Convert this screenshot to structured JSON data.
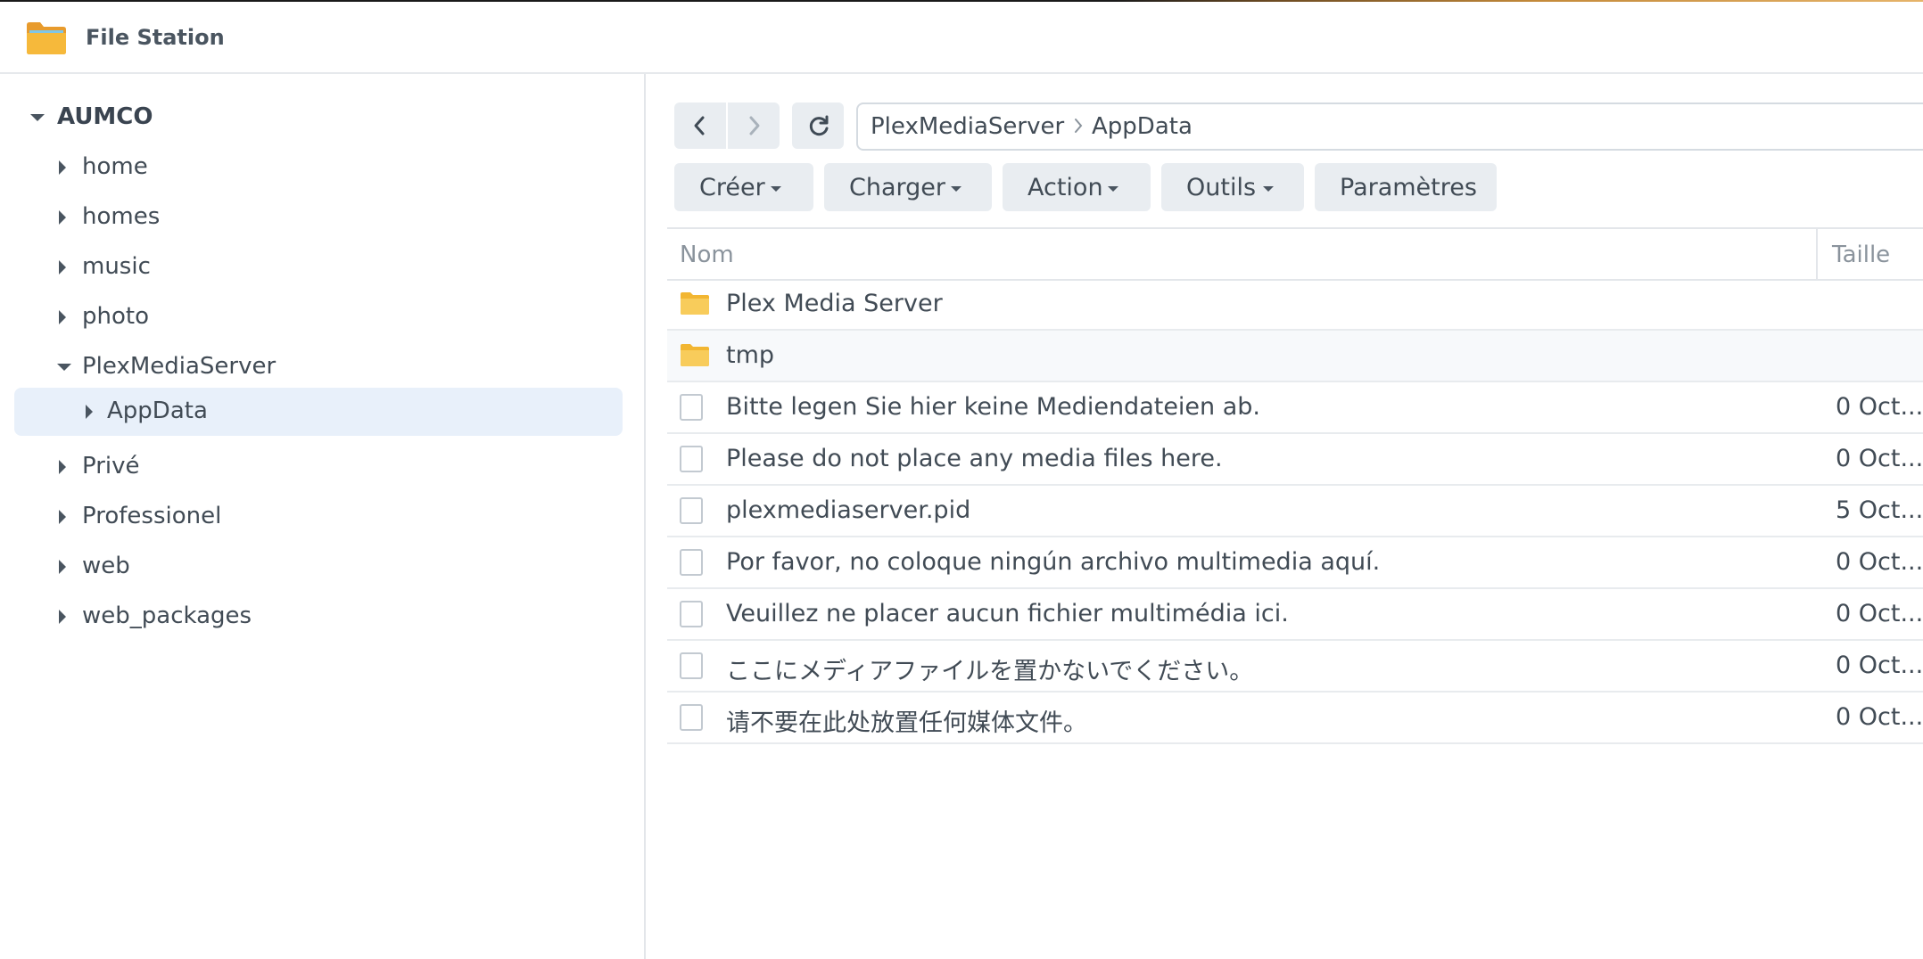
{
  "app": {
    "title": "File Station",
    "icon": "folder-app-icon"
  },
  "colors": {
    "accent": "#e8f0fa",
    "folder": "#f7c64a",
    "text": "#414b55",
    "muted": "#8a939c"
  },
  "tree": {
    "root": "AUMCO",
    "items": [
      {
        "label": "home",
        "expanded": false
      },
      {
        "label": "homes",
        "expanded": false
      },
      {
        "label": "music",
        "expanded": false
      },
      {
        "label": "photo",
        "expanded": false
      },
      {
        "label": "PlexMediaServer",
        "expanded": true
      },
      {
        "label": "AppData",
        "selected": true,
        "child": true
      },
      {
        "label": "Privé",
        "expanded": false
      },
      {
        "label": "Professionel",
        "expanded": false
      },
      {
        "label": "web",
        "expanded": false
      },
      {
        "label": "web_packages",
        "expanded": false
      }
    ]
  },
  "path": {
    "segments": [
      "PlexMediaServer",
      "AppData"
    ]
  },
  "toolbar": {
    "create": "Créer",
    "upload": "Charger",
    "action": "Action",
    "tools": "Outils",
    "settings": "Paramètres"
  },
  "grid": {
    "columns": {
      "name": "Nom",
      "size": "Taille"
    },
    "rows": [
      {
        "name": "Plex Media Server",
        "type": "folder",
        "size": ""
      },
      {
        "name": "tmp",
        "type": "folder",
        "size": ""
      },
      {
        "name": "Bitte legen Sie hier keine Mediendateien ab.",
        "type": "file",
        "size": "0 Oct..."
      },
      {
        "name": "Please do not place any media files here.",
        "type": "file",
        "size": "0 Oct..."
      },
      {
        "name": "plexmediaserver.pid",
        "type": "file",
        "size": "5 Oct..."
      },
      {
        "name": "Por favor, no coloque ningún archivo multimedia aquí.",
        "type": "file",
        "size": "0 Oct..."
      },
      {
        "name": "Veuillez ne placer aucun fichier multimédia ici.",
        "type": "file",
        "size": "0 Oct..."
      },
      {
        "name": "ここにメディアファイルを置かないでください。",
        "type": "file",
        "size": "0 Oct..."
      },
      {
        "name": "请不要在此处放置任何媒体文件。",
        "type": "file",
        "size": "0 Oct..."
      }
    ]
  }
}
